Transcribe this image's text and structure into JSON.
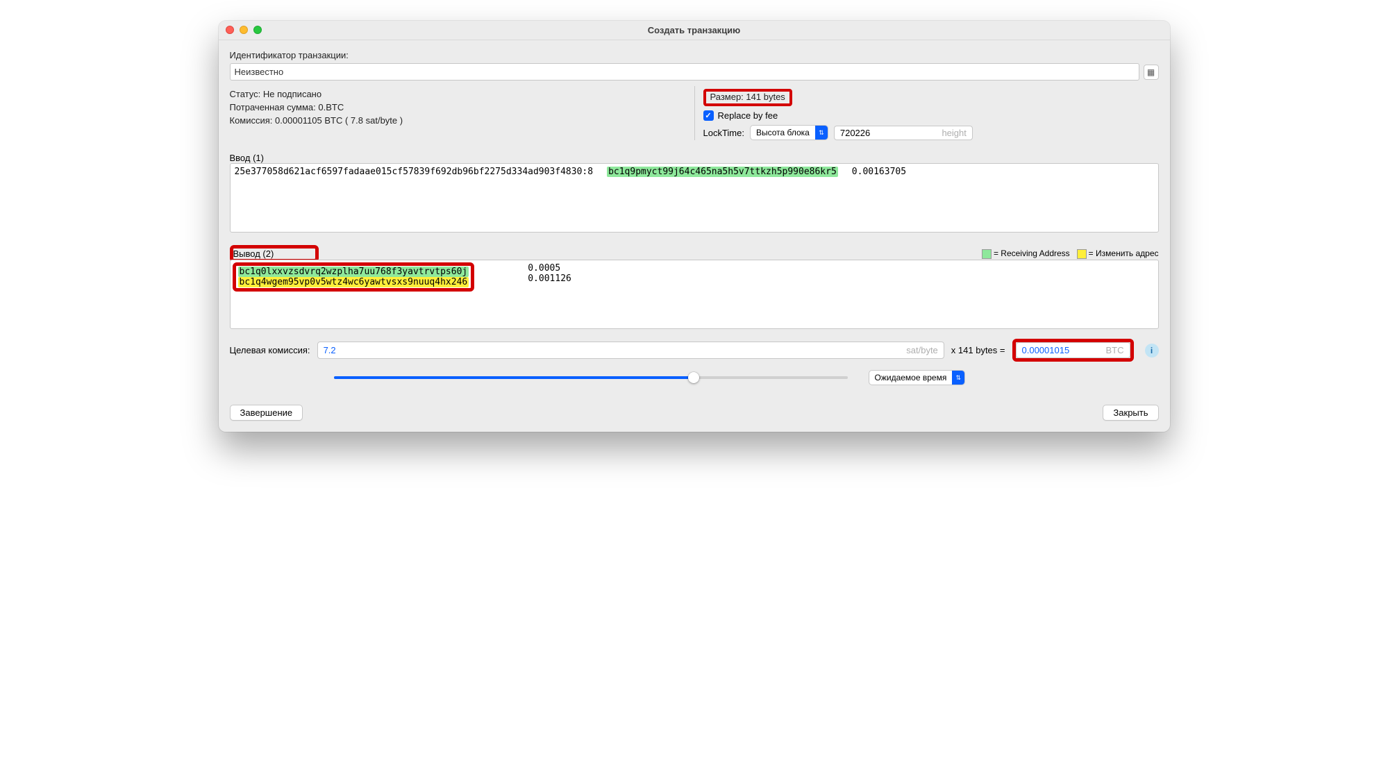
{
  "window": {
    "title": "Создать транзакцию"
  },
  "txid": {
    "label": "Идентификатор транзакции:",
    "value": "Неизвестно"
  },
  "status": {
    "label": "Статус:",
    "value": "Не подписано"
  },
  "spent": {
    "label": "Потраченная сумма:",
    "value": "0.BTC"
  },
  "fee": {
    "label": "Комиссия:",
    "value": "0.00001105 BTC  ( 7.8 sat/byte )"
  },
  "size": {
    "label": "Размер:",
    "value": "141 bytes"
  },
  "rbf": {
    "label": "Replace by fee",
    "checked": true
  },
  "locktime": {
    "label": "LockTime:",
    "select": "Высота блока",
    "value": "720226",
    "unit": "height"
  },
  "inputs": {
    "label": "Ввод (1)",
    "rows": [
      {
        "prev": "25e377058d621acf6597fadaae015cf57839f692db96bf2275d334ad903f4830:8",
        "addr": "bc1q9pmyct99j64c465na5h5v7ttkzh5p990e86kr5",
        "amount": "0.00163705"
      }
    ]
  },
  "outputs": {
    "label": "Вывод (2)",
    "legend": {
      "recv": "= Receiving Address",
      "chg": "= Изменить адрес"
    },
    "rows": [
      {
        "addr": "bc1q0lxxvzsdvrq2wzplha7uu768f3yavtrvtps60j",
        "amount": "0.0005",
        "type": "recv"
      },
      {
        "addr": "bc1q4wgem95vp0v5wtz4wc6yawtvsxs9nuuq4hx246",
        "amount": "0.001126",
        "type": "chg"
      }
    ]
  },
  "target_fee": {
    "label": "Целевая комиссия:",
    "rate": "7.2",
    "rate_unit": "sat/byte",
    "mult": "x  141 bytes  =",
    "btc": "0.00001015",
    "btc_unit": "BTC",
    "time_select": "Ожидаемое время"
  },
  "footer": {
    "finish": "Завершение",
    "close": "Закрыть"
  }
}
